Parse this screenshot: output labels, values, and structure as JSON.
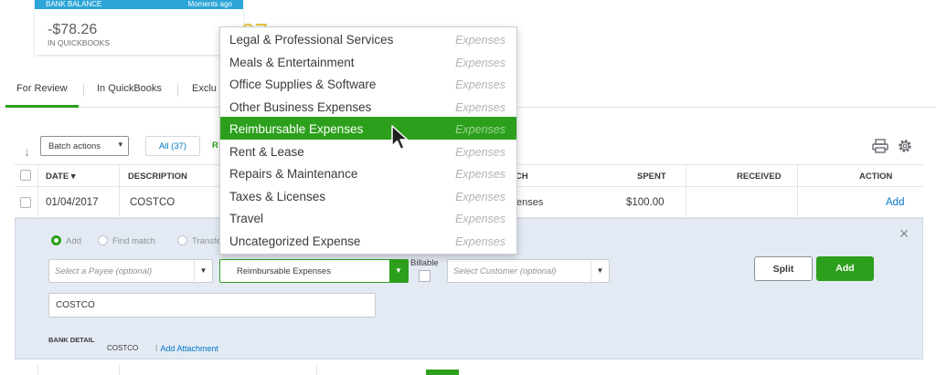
{
  "bank_card": {
    "bar_label": "BANK BALANCE",
    "bar_time": "Moments ago",
    "balance": "-$78.26",
    "sub_label": "IN QUICKBOOKS",
    "count": "37"
  },
  "tabs": [
    {
      "label": "For Review",
      "active": true
    },
    {
      "label": "In QuickBooks",
      "active": false
    },
    {
      "label": "Exclu",
      "active": false
    }
  ],
  "toolbar": {
    "batch_label": "Batch actions",
    "all_label": "All (37)",
    "recognized_label": "R"
  },
  "table": {
    "headers": {
      "date": "DATE",
      "description": "DESCRIPTION",
      "match": "CH",
      "spent": "SPENT",
      "received": "RECEIVED",
      "action": "ACTION"
    },
    "row": {
      "date": "01/04/2017",
      "description": "COSTCO",
      "category": "enses",
      "spent": "$100.00",
      "received": "",
      "action": "Add"
    }
  },
  "panel": {
    "radios": [
      {
        "label": "Add",
        "selected": true
      },
      {
        "label": "Find match",
        "selected": false
      },
      {
        "label": "Transfe",
        "selected": false
      }
    ],
    "payee_placeholder": "Select a Payee (optional)",
    "category_value": "Reimbursable Expenses",
    "billable_label": "Billable",
    "customer_placeholder": "Select Customer (optional)",
    "split_label": "Split",
    "add_label": "Add",
    "memo_value": "COSTCO",
    "bank_detail_label": "BANK DETAIL",
    "bank_detail_value": "COSTCO",
    "attachment_label": "Add Attachment"
  },
  "dropdown": {
    "options": [
      {
        "name": "Legal & Professional Services",
        "type": "Expenses",
        "highlighted": false
      },
      {
        "name": "Meals & Entertainment",
        "type": "Expenses",
        "highlighted": false
      },
      {
        "name": "Office Supplies & Software",
        "type": "Expenses",
        "highlighted": false
      },
      {
        "name": "Other Business Expenses",
        "type": "Expenses",
        "highlighted": false
      },
      {
        "name": "Reimbursable Expenses",
        "type": "Expenses",
        "highlighted": true
      },
      {
        "name": "Rent & Lease",
        "type": "Expenses",
        "highlighted": false
      },
      {
        "name": "Repairs & Maintenance",
        "type": "Expenses",
        "highlighted": false
      },
      {
        "name": "Taxes & Licenses",
        "type": "Expenses",
        "highlighted": false
      },
      {
        "name": "Travel",
        "type": "Expenses",
        "highlighted": false
      },
      {
        "name": "Uncategorized Expense",
        "type": "Expenses",
        "highlighted": false
      }
    ]
  },
  "colors": {
    "accent_green": "#2ca01c",
    "link_blue": "#0077c5",
    "panel_bg": "#e4eaf4"
  },
  "icons": [
    "sort-arrow-icon",
    "print-icon",
    "gear-icon",
    "close-icon",
    "paperclip-icon",
    "chevron-down-icon",
    "mouse-cursor-icon"
  ]
}
